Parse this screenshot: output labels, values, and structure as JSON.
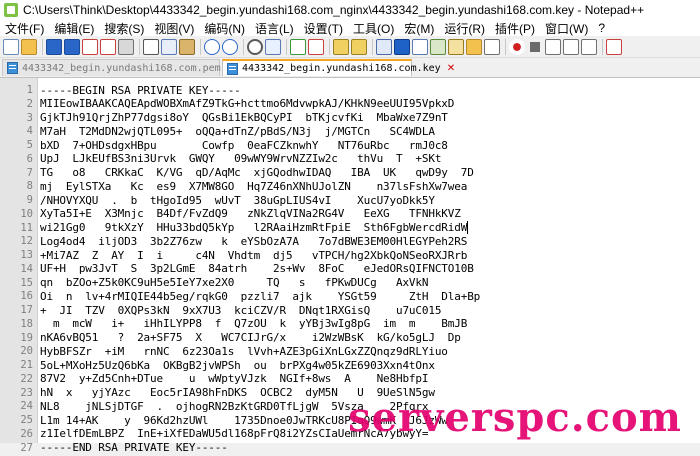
{
  "window": {
    "title": "C:\\Users\\Think\\Desktop\\4433342_begin.yundashi168.com_nginx\\4433342_begin.yundashi168.com.key - Notepad++"
  },
  "menu": [
    "文件(F)",
    "编辑(E)",
    "搜索(S)",
    "视图(V)",
    "编码(N)",
    "语言(L)",
    "设置(T)",
    "工具(O)",
    "宏(M)",
    "运行(R)",
    "插件(P)",
    "窗口(W)",
    "?"
  ],
  "toolbar": {
    "icons": [
      "new-file-icon",
      "open-file-icon",
      "save-icon",
      "save-all-icon",
      "close-icon",
      "close-all-icon",
      "print-icon",
      "cut-icon",
      "copy-icon",
      "paste-icon",
      "undo-icon",
      "redo-icon",
      "find-icon",
      "replace-icon",
      "zoom-in-icon",
      "zoom-out-icon",
      "sync-vertical-icon",
      "sync-horizontal-icon",
      "word-wrap-icon",
      "show-all-chars-icon",
      "indent-guide-icon",
      "doc-map-icon",
      "function-list-icon",
      "folder-workspace-icon",
      "monitoring-icon",
      "record-macro-icon",
      "stop-macro-icon",
      "play-macro-icon",
      "play-multiple-icon",
      "save-macro-icon",
      "spellcheck-icon"
    ],
    "colors": {
      "accent": "#1e62c8",
      "record": "#d02020",
      "disk": "#2a66c8"
    }
  },
  "tabs": [
    {
      "label": "4433342_begin.yundashi168.com.pem",
      "active": false
    },
    {
      "label": "4433342_begin.yundashi168.com.key",
      "active": true
    }
  ],
  "editor": {
    "caret_line": 10,
    "lines": [
      "-----BEGIN RSA PRIVATE KEY-----",
      "MIIEowIBAAKCAQEApdWOBXmAfZ9TkG+hcttmo6MdvwpkAJ/KHkN9eeUUI95VpkxD",
      "GjkTJh91QrjZhP77dgsi8oY  QGsBi1EkBQCyPI  bTKjcvfKi  MbaWxe7Z9nT",
      "M7aH  T2MdDN2wjQTL095+  oQQa+dTnZ/pBdS/N3j  j/MGTCn   SC4WDLA",
      "bXD  7+OHDsdgxHBpu       Cowfp  0eaFCZknwhY   NT76uRbc   rmJ0c8",
      "UpJ  LJkEUfBS3ni3Urvk  GWQY   09wWY9WrvNZZIw2c   thVu  T  +SKt",
      "TG   o8   CRKkaC  K/VG  qD/AqMc  xjGQodhwIDAQ   IBA  UK   qwD9y  7D",
      "mj  EylSTXa   Kc  es9  X7MW8GO  Hq7Z46nXNhUJolZN    n37lsFshXw7wea",
      "/NHOVYXQU  .  b  tHgoId95  wUvT  38uGpLIUS4vI    XucU7yoDkk5Y",
      "XyTa5I+E  X3Mnjc  B4Df/FvZdQ9   zNkZlqVINa2RG4V   EeXG   TFNHkKVZ",
      "wi21Gg0   9tkXzY  HHu33bdQ5kYp   l2RAaiHzmRtFpiE  Sth6FgbWercdRidW",
      "Log4od4  iljOD3  3b2Z76zw   k  eYSbOzA7A   7o7dBWE3EM00HlEGYPeh2RS",
      "+Mi7AZ  Z  AY  I  i     c4N  Vhdtm  dj5   vTPCH/hg2XbkQoNSeoRXJRrb",
      "UF+H  pw3JvT  S  3p2LGmE  84atrh    2s+Wv  8FoC   eJedORsQIFNCTO10B",
      "qn  bZOo+Z5k0KC9uH5e5IeY7xe2X0     TQ   s   fPKwDUCg   AxVkN",
      "Oi  n  lv+4rMIQIE44b5eg/rqkG0  pzzli7  ajk    YSGt59     ZtH  Dla+Bp",
      "+  JI  TZV  0XQPs3kN  9xX7U3  kciCZV/R  DNqt1RXGisQ    u7uC015",
      "  m  mcW   i+   iHhILYPP8  f  Q7zOU  k  yYBj3wIg8pG  im  m    BmJB",
      "nKA6vBQ51   ?  2a+SF75  X   WC7CIJrG/x    i2WzWBsK  kG/ko5gLJ  Dp",
      "HybBFSZr  +iM   rnNC  6z23Oa1s  lVvh+AZE3pGiXnLGxZZQnqz9dRLYiuo",
      "5oL+MXoHz5UzQ6bKa  OKBgB2jvWPSh  ou  brPXg4w05kZE6903Xxn4tOnx",
      "87V2  y+Zd5Cnh+DTue    u  wWptyVJzk  NGIf+8ws  A    Ne8HbfpI",
      "hN  x   yjYAzc   Eoc5rIA98hFnDKS  OCBC2  dyM5N   U  9UeSlN5gw",
      "NL8    jNLSjDTGF  .  ojhogRN2BzKtGRD0TfLjgW  5Vsza    2Pfqrx",
      "L1m 14+AK    y  96Kd2hzUWl    1735Dnoe0JwTRKcU8PIqQ9wmK  J6JzWw",
      "z1IelfDEmLBPZ  InE+iXfEDaWU5dl168pFrQ8i2YZsCIaUemrNcA7ybwyY=",
      "-----END RSA PRIVATE KEY-----"
    ]
  },
  "watermark": "serverspc.com"
}
